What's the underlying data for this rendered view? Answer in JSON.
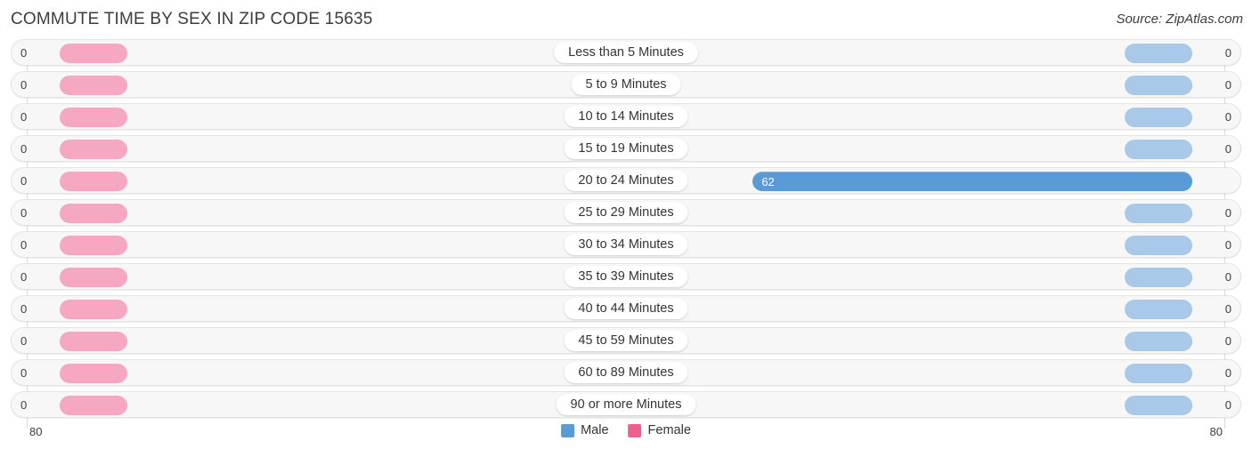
{
  "header": {
    "title": "COMMUTE TIME BY SEX IN ZIP CODE 15635",
    "source": "Source: ZipAtlas.com"
  },
  "legend": {
    "male_label": "Male",
    "female_label": "Female",
    "male_color": "#5b9bd5",
    "female_color": "#ef5f8e"
  },
  "axis": {
    "left_end": "80",
    "right_end": "80",
    "max": 80
  },
  "chart_data": {
    "type": "bar",
    "orientation": "horizontal-diverging",
    "title": "COMMUTE TIME BY SEX IN ZIP CODE 15635",
    "xlabel": "",
    "ylabel": "",
    "xlim": [
      80,
      0,
      80
    ],
    "grid": false,
    "legend_position": "bottom-center",
    "categories": [
      "Less than 5 Minutes",
      "5 to 9 Minutes",
      "10 to 14 Minutes",
      "15 to 19 Minutes",
      "20 to 24 Minutes",
      "25 to 29 Minutes",
      "30 to 34 Minutes",
      "35 to 39 Minutes",
      "40 to 44 Minutes",
      "45 to 59 Minutes",
      "60 to 89 Minutes",
      "90 or more Minutes"
    ],
    "series": [
      {
        "name": "Male",
        "side": "left",
        "color": "#5b9bd5",
        "values": [
          0,
          0,
          0,
          0,
          62,
          0,
          0,
          0,
          0,
          0,
          0,
          0
        ]
      },
      {
        "name": "Female",
        "side": "right",
        "color": "#ef5f8e",
        "values": [
          0,
          0,
          0,
          0,
          0,
          0,
          0,
          0,
          0,
          0,
          0,
          0
        ]
      }
    ],
    "male_labels": [
      "0",
      "0",
      "0",
      "0",
      "62",
      "0",
      "0",
      "0",
      "0",
      "0",
      "0",
      "0"
    ],
    "female_labels": [
      "0",
      "0",
      "0",
      "0",
      "0",
      "0",
      "0",
      "0",
      "0",
      "0",
      "0",
      "0"
    ]
  }
}
